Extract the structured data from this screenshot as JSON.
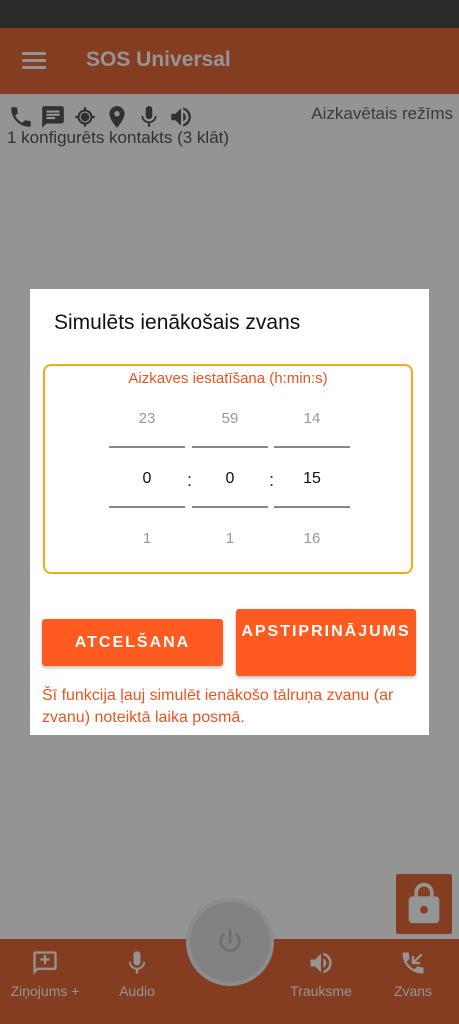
{
  "app": {
    "title": "SOS Universal"
  },
  "status": {
    "delayed_mode": "Aizkavētais režīms",
    "contacts": "1 konfigurēts kontakts (3 klāt)",
    "icons": [
      "phone-icon",
      "message-icon",
      "gps-target-icon",
      "location-pin-icon",
      "microphone-icon",
      "speaker-icon"
    ]
  },
  "dialog": {
    "title": "Simulēts ienākošais zvans",
    "picker_label": "Aizkaves iestatīšana (h:min:s)",
    "hours": {
      "prev": "23",
      "current": "0",
      "next": "1"
    },
    "minutes": {
      "prev": "59",
      "current": "0",
      "next": "1"
    },
    "seconds": {
      "prev": "14",
      "current": "15",
      "next": "16"
    },
    "separator": ":",
    "cancel_label": "ATCELŠANA",
    "confirm_label": "APSTIPRINĀJUMS",
    "info_text": "Šī funkcija ļauj simulēt ienākošo tālruņa zvanu (ar zvanu) noteiktā laika posmā."
  },
  "nav": {
    "messages": "Ziņojums +",
    "audio": "Audio",
    "alarm": "Trauksme",
    "call": "Zvans"
  },
  "colors": {
    "accent": "#e56a3a",
    "button": "#ff5a1f",
    "picker_border": "#f3a91f"
  }
}
